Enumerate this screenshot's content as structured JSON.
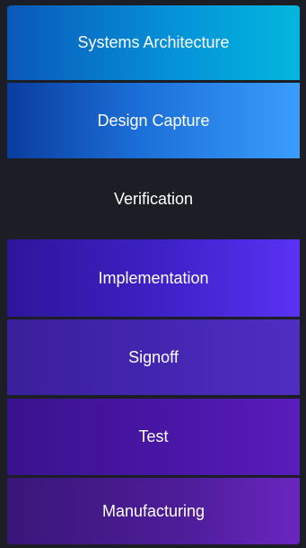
{
  "menu": {
    "items": [
      {
        "label": "Systems Architecture"
      },
      {
        "label": "Design Capture"
      },
      {
        "label": "Verification"
      },
      {
        "label": "Implementation"
      },
      {
        "label": "Signoff"
      },
      {
        "label": "Test"
      },
      {
        "label": "Manufacturing"
      }
    ]
  }
}
